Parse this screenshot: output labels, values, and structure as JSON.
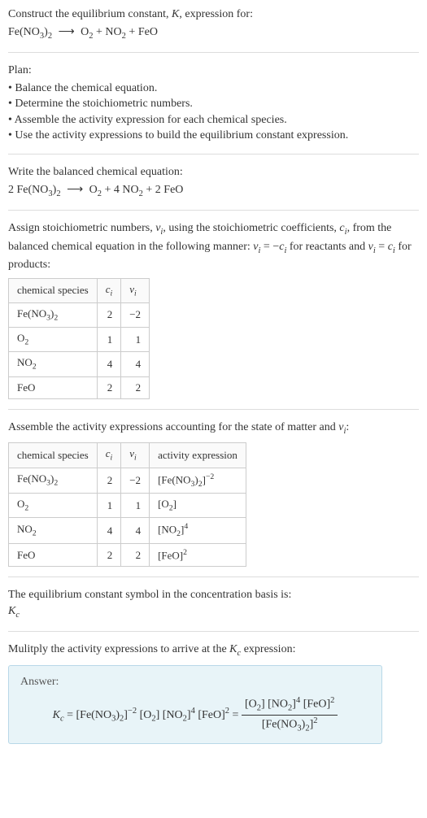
{
  "intro": {
    "line1_pre": "Construct the equilibrium constant, ",
    "line1_K": "K",
    "line1_post": ", expression for:",
    "eq_left": "Fe(NO",
    "eq_sub1": "3",
    "eq_close": ")",
    "eq_sub2": "2",
    "arrow": "⟶",
    "eq_o2": "O",
    "eq_sub_o2": "2",
    "plus": " + ",
    "eq_no2": "NO",
    "eq_sub_no2": "2",
    "eq_feo": "FeO"
  },
  "plan": {
    "title": "Plan:",
    "items": [
      "• Balance the chemical equation.",
      "• Determine the stoichiometric numbers.",
      "• Assemble the activity expression for each chemical species.",
      "• Use the activity expressions to build the equilibrium constant expression."
    ]
  },
  "balanced": {
    "title": "Write the balanced chemical equation:",
    "c1": "2 Fe(NO",
    "sub3": "3",
    "close": ")",
    "sub2": "2",
    "arrow": "⟶",
    "o2": "O",
    "o2sub": "2",
    "plus4": " + 4 NO",
    "no2sub": "2",
    "plusfeo": " + 2 FeO"
  },
  "stoich": {
    "intro_pre": "Assign stoichiometric numbers, ",
    "nu": "ν",
    "sub_i": "i",
    "intro_mid": ", using the stoichiometric coefficients, ",
    "c": "c",
    "intro_post": ", from the balanced chemical equation in the following manner: ",
    "eq1_lhs": "ν",
    "eq1_eq": " = −",
    "eq1_rhs": "c",
    "eq1_tail": " for reactants and ",
    "eq2_lhs": "ν",
    "eq2_eq": " = ",
    "eq2_rhs": "c",
    "eq2_tail": " for products:",
    "headers": {
      "species": "chemical species",
      "ci": "c",
      "ci_sub": "i",
      "nui": "ν",
      "nui_sub": "i"
    },
    "rows": [
      {
        "species_pre": "Fe(NO",
        "sub1": "3",
        "close": ")",
        "sub2": "2",
        "ci": "2",
        "nui": "−2"
      },
      {
        "species_pre": "O",
        "sub1": "2",
        "close": "",
        "sub2": "",
        "ci": "1",
        "nui": "1"
      },
      {
        "species_pre": "NO",
        "sub1": "2",
        "close": "",
        "sub2": "",
        "ci": "4",
        "nui": "4"
      },
      {
        "species_pre": "FeO",
        "sub1": "",
        "close": "",
        "sub2": "",
        "ci": "2",
        "nui": "2"
      }
    ]
  },
  "activity": {
    "intro_pre": "Assemble the activity expressions accounting for the state of matter and ",
    "nu": "ν",
    "sub_i": "i",
    "intro_post": ":",
    "headers": {
      "species": "chemical species",
      "ci": "c",
      "ci_sub": "i",
      "nui": "ν",
      "nui_sub": "i",
      "activity": "activity expression"
    },
    "rows": [
      {
        "sp_pre": "Fe(NO",
        "sp_s1": "3",
        "sp_c": ")",
        "sp_s2": "2",
        "ci": "2",
        "nui": "−2",
        "act_open": "[Fe(NO",
        "act_s1": "3",
        "act_close1": ")",
        "act_s2": "2",
        "act_close2": "]",
        "act_sup": "−2"
      },
      {
        "sp_pre": "O",
        "sp_s1": "2",
        "sp_c": "",
        "sp_s2": "",
        "ci": "1",
        "nui": "1",
        "act_open": "[O",
        "act_s1": "2",
        "act_close1": "",
        "act_s2": "",
        "act_close2": "]",
        "act_sup": ""
      },
      {
        "sp_pre": "NO",
        "sp_s1": "2",
        "sp_c": "",
        "sp_s2": "",
        "ci": "4",
        "nui": "4",
        "act_open": "[NO",
        "act_s1": "2",
        "act_close1": "",
        "act_s2": "",
        "act_close2": "]",
        "act_sup": "4"
      },
      {
        "sp_pre": "FeO",
        "sp_s1": "",
        "sp_c": "",
        "sp_s2": "",
        "ci": "2",
        "nui": "2",
        "act_open": "[FeO",
        "act_s1": "",
        "act_close1": "",
        "act_s2": "",
        "act_close2": "]",
        "act_sup": "2"
      }
    ]
  },
  "basis": {
    "line1": "The equilibrium constant symbol in the concentration basis is:",
    "K": "K",
    "sub": "c"
  },
  "multiply": {
    "line_pre": "Mulitply the activity expressions to arrive at the ",
    "K": "K",
    "sub": "c",
    "line_post": " expression:"
  },
  "answer": {
    "label": "Answer:",
    "K": "K",
    "sub": "c",
    "eq": " = ",
    "t1_open": "[Fe(NO",
    "t1_s1": "3",
    "t1_close1": ")",
    "t1_s2": "2",
    "t1_close2": "]",
    "t1_sup": "−2",
    "sp": " ",
    "t2_open": "[O",
    "t2_s1": "2",
    "t2_close": "]",
    "t3_open": "[NO",
    "t3_s1": "2",
    "t3_close": "]",
    "t3_sup": "4",
    "t4_open": "[FeO]",
    "t4_sup": "2",
    "eq2": " = ",
    "num_t2_open": "[O",
    "num_t2_s1": "2",
    "num_t2_close": "] ",
    "num_t3_open": "[NO",
    "num_t3_s1": "2",
    "num_t3_close": "]",
    "num_t3_sup": "4",
    "num_sp": " ",
    "num_t4_open": "[FeO]",
    "num_t4_sup": "2",
    "den_open": "[Fe(NO",
    "den_s1": "3",
    "den_close1": ")",
    "den_s2": "2",
    "den_close2": "]",
    "den_sup": "2"
  }
}
